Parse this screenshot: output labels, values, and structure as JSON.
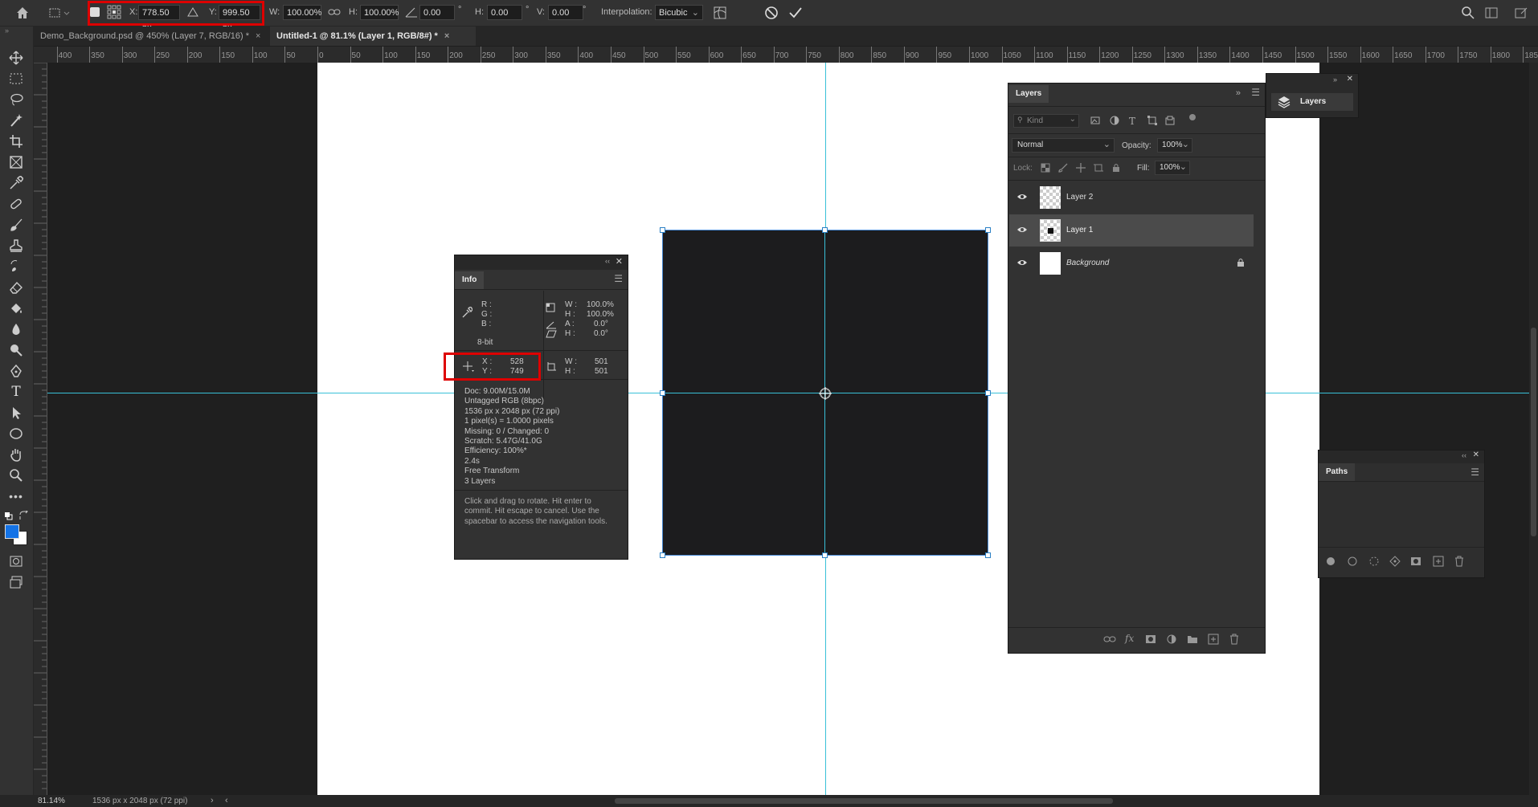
{
  "options_bar": {
    "x_label": "X:",
    "x_value": "778.50 px",
    "y_label": "Y:",
    "y_value": "999.50 px",
    "w_label": "W:",
    "w_value": "100.00%",
    "h_label": "H:",
    "h_value": "100.00%",
    "angle_value": "0.00",
    "hskew_label": "H:",
    "hskew_value": "0.00",
    "vskew_label": "V:",
    "vskew_value": "0.00",
    "degree": "°",
    "interpolation_label": "Interpolation:",
    "interpolation_value": "Bicubic"
  },
  "tabs": [
    {
      "label": "Demo_Background.psd @ 450% (Layer 7, RGB/16) *",
      "close": "×"
    },
    {
      "label": "Untitled-1 @ 81.1% (Layer 1, RGB/8#) *",
      "close": "×"
    }
  ],
  "ruler": {
    "h_ticks": [
      "400",
      "350",
      "300",
      "250",
      "200",
      "150",
      "100",
      "50",
      "0",
      "50",
      "100",
      "150",
      "200",
      "250",
      "300",
      "350",
      "400",
      "450",
      "500",
      "550",
      "600",
      "650",
      "700",
      "750",
      "800",
      "850",
      "900",
      "950",
      "1000",
      "1050",
      "1100",
      "1150",
      "1200",
      "1250",
      "1300",
      "1350",
      "1400",
      "1450",
      "1500",
      "1550",
      "1600",
      "1650",
      "1700",
      "1750",
      "1800",
      "1850"
    ]
  },
  "info_panel": {
    "tab": "Info",
    "r": "R :",
    "g": "G :",
    "b": "B :",
    "bit": "8-bit",
    "w_pct_label": "W :",
    "w_pct": "100.0%",
    "h_pct_label": "H :",
    "h_pct": "100.0%",
    "a_label": "A :",
    "a_val": "0.0°",
    "h2_label": "H :",
    "h2_val": "0.0°",
    "x_label": "X :",
    "x_val": "528",
    "y_label": "Y :",
    "y_val": "749",
    "w_label": "W :",
    "w_val": "501",
    "h_label": "H :",
    "h_val": "501",
    "doc_lines": [
      "Doc: 9.00M/15.0M",
      "Untagged RGB (8bpc)",
      "1536 px x 2048 px (72 ppi)",
      "1 pixel(s) = 1.0000 pixels",
      "Missing: 0 / Changed: 0",
      "Scratch: 5.47G/41.0G",
      "Efficiency: 100%*",
      "2.4s",
      "Free Transform",
      "3 Layers"
    ],
    "hint": "Click and drag to rotate. Hit enter to commit. Hit escape to cancel. Use the spacebar to access the navigation tools."
  },
  "layers_panel": {
    "tab": "Layers",
    "kind_placeholder": "Kind",
    "blend_mode": "Normal",
    "opacity_label": "Opacity:",
    "opacity_value": "100%",
    "lock_label": "Lock:",
    "fill_label": "Fill:",
    "fill_value": "100%",
    "layers": [
      {
        "name": "Layer 2"
      },
      {
        "name": "Layer 1"
      },
      {
        "name": "Background"
      }
    ]
  },
  "collapsed_layers": {
    "label": "Layers"
  },
  "paths_panel": {
    "tab": "Paths"
  },
  "status": {
    "zoom": "81.14%",
    "doc_size": "1536 px x 2048 px (72 ppi)"
  },
  "colors": {
    "accent": "#39c0d8",
    "highlight": "#d00000",
    "foreground": "#1473e6",
    "shape": "#1c1c1e"
  }
}
